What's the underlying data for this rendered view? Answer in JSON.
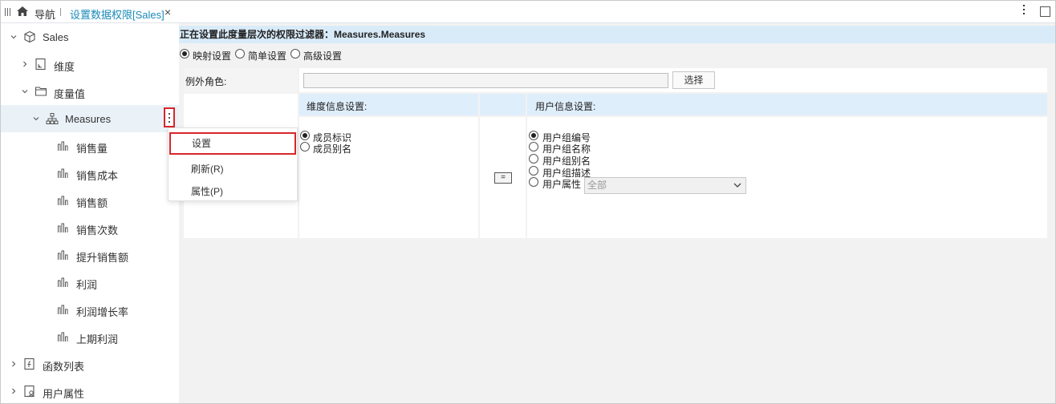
{
  "topbar": {
    "nav_label": "导航",
    "tab_title": "设置数据权限[Sales]",
    "close_glyph": "×"
  },
  "tree": {
    "root": "Sales",
    "dimension": "维度",
    "measures_group": "度量值",
    "measures": "Measures",
    "items": [
      "销售量",
      "销售成本",
      "销售额",
      "销售次数",
      "提升销售额",
      "利润",
      "利润增长率",
      "上期利润"
    ],
    "functions": "函数列表",
    "user_attrs": "用户属性"
  },
  "context_menu": {
    "items": [
      "设置",
      "刷新(R)",
      "属性(P)"
    ]
  },
  "main": {
    "header": "正在设置此度量层次的权限过滤器：Measures.Measures",
    "modes": [
      "映射设置",
      "简单设置",
      "高级设置"
    ],
    "selected_mode": "映射设置",
    "exception_role_label": "例外角色:",
    "exception_role_value": "",
    "select_button": "选择",
    "dim_header": "维度信息设置:",
    "user_header": "用户信息设置:",
    "dim_options": [
      "成员标识",
      "成员别名"
    ],
    "dim_selected": "成员标识",
    "equals": "=",
    "user_options": [
      "用户组编号",
      "用户组名称",
      "用户组别名",
      "用户组描述",
      "用户属性"
    ],
    "user_selected": "用户组编号",
    "user_attr_select": "全部"
  },
  "colors": {
    "accent": "#1a8ab8",
    "highlight_border": "#d9262a",
    "header_bg": "#d9ebf9",
    "cell_header_bg": "#dfeefb"
  }
}
